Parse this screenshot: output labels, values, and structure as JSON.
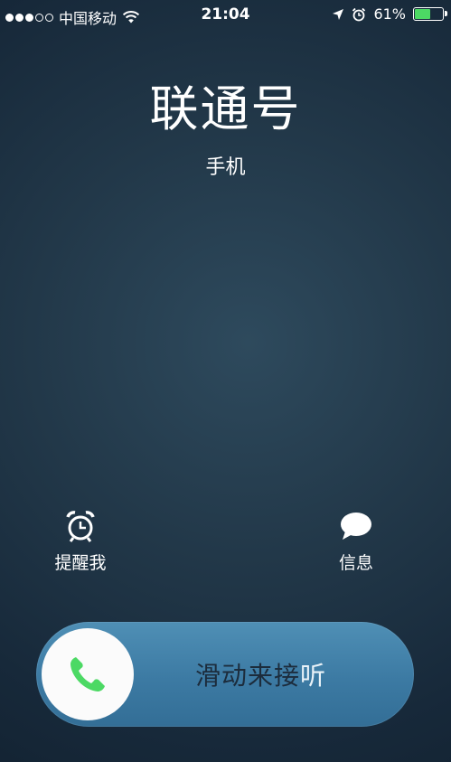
{
  "status_bar": {
    "signal_dots_filled": 3,
    "signal_dots_total": 5,
    "carrier": "中国移动",
    "time": "21:04",
    "battery_percent_label": "61%",
    "battery_level": 0.61
  },
  "call": {
    "caller_name": "联通号",
    "number_type": "手机"
  },
  "actions": {
    "remind_label": "提醒我",
    "message_label": "信息"
  },
  "slider": {
    "text_part1": "滑动来接",
    "text_part2": "听"
  },
  "colors": {
    "accent_green": "#4cd964",
    "slider_blue": "#3c7aa3"
  }
}
